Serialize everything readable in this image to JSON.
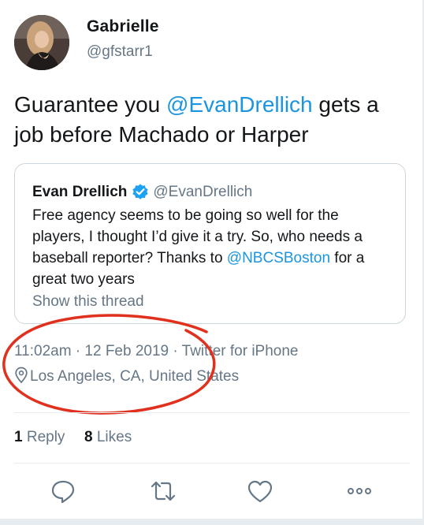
{
  "author": {
    "display_name": "Gabrielle",
    "handle": "@gfstarr1"
  },
  "tweet": {
    "text_before": "Guarantee you ",
    "mention": "@EvanDrellich",
    "text_after": " gets a job before Machado or Harper"
  },
  "quoted": {
    "display_name": "Evan Drellich",
    "handle": "@EvanDrellich",
    "text": "Free agency seems to be going so well for the players, I thought I’d give it a try. So, who needs a baseball reporter? Thanks to ",
    "mention": "@NBCSBoston",
    "text_after": " for a great two years",
    "show_thread": "Show this thread"
  },
  "meta": {
    "timestamp": "11:02am · 12 Feb 2019 · Twitter for iPhone",
    "location": "Los Angeles, CA, United States"
  },
  "stats": {
    "replies_count": "1",
    "replies_label": "Reply",
    "likes_count": "8",
    "likes_label": "Likes"
  },
  "icons": {
    "reply": "reply-icon",
    "retweet": "retweet-icon",
    "like": "like-icon",
    "more": "more-icon",
    "location": "location-pin-icon",
    "verified": "verified-badge-icon"
  },
  "colors": {
    "link": "#1b95e0",
    "secondary_text": "#657786",
    "annotation": "#e0301e",
    "verified": "#1da1f2"
  }
}
